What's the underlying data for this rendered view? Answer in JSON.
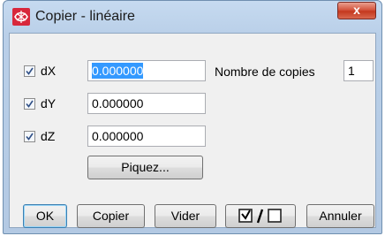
{
  "window": {
    "title": "Copier - linéaire",
    "close_label": "x",
    "icon": "app-logo-icon"
  },
  "offsets": [
    {
      "label": "dX",
      "checked": true,
      "value": "0.000000",
      "selected": true
    },
    {
      "label": "dY",
      "checked": true,
      "value": "0.000000",
      "selected": false
    },
    {
      "label": "dZ",
      "checked": true,
      "value": "0.000000",
      "selected": false
    }
  ],
  "copies": {
    "label": "Nombre de copies",
    "value": "1"
  },
  "pick_button": "Piquez...",
  "buttons": {
    "ok": "OK",
    "copy": "Copier",
    "clear": "Vider",
    "toggle_icon": "check-toggle-icon",
    "cancel": "Annuler"
  },
  "colors": {
    "selection": "#3399ff",
    "titlebar": "#b9cfe8",
    "close": "#c4381f"
  }
}
